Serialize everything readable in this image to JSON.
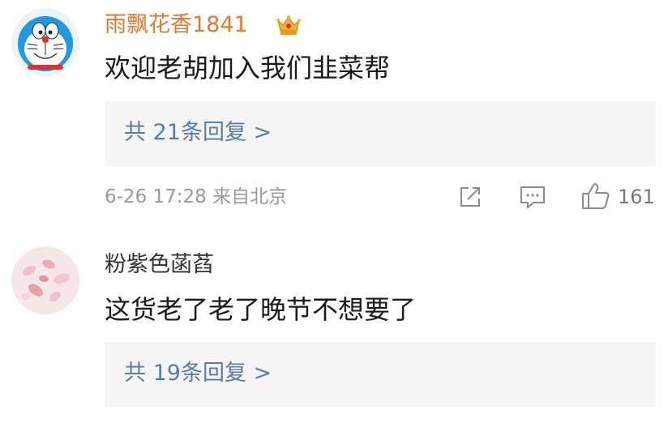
{
  "comments": [
    {
      "username": "雨飘花香1841",
      "text": "欢迎老胡加入我们韭菜帮",
      "reply_link": "共 21条回复 >",
      "meta": "6-26 17:28  来自北京",
      "like_count": "161",
      "username_color": "#e07a2e",
      "avatar": "doraemon-avatar",
      "badge": "crown-vip-badge"
    },
    {
      "username": "粉紫色菡萏",
      "text": "这货老了老了晚节不想要了",
      "reply_link": "共 19条回复 >",
      "username_color": "#333333",
      "avatar": "petals-avatar"
    }
  ],
  "colors": {
    "link": "#5b7ba8",
    "reply_bg": "#f5f5f5",
    "meta": "#9a9a9a",
    "icon": "#8a8a8a"
  }
}
